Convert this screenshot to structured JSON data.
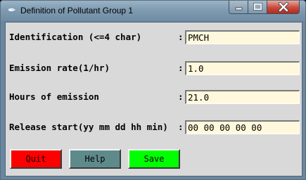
{
  "window": {
    "title": "Definition of Pollutant Group 1",
    "icon": "feather-icon"
  },
  "form": {
    "fields": [
      {
        "label": "Identification (<=4 char)",
        "value": "PMCH"
      },
      {
        "label": "Emission rate(1/hr)",
        "value": "1.0"
      },
      {
        "label": "Hours of emission",
        "value": "21.0"
      },
      {
        "label": "Release start(yy mm dd hh min)",
        "value": "00 00 00 00 00"
      }
    ],
    "separator": ":"
  },
  "buttons": {
    "quit": {
      "label": "Quit",
      "color": "#ff0000"
    },
    "help": {
      "label": "Help",
      "color": "#5f8a8b"
    },
    "save": {
      "label": "Save",
      "color": "#00ff00"
    }
  },
  "colors": {
    "client_bg": "#d9d9d9",
    "field_bg": "#fff8dc",
    "titlebar": "#7f9bb1",
    "close_button": "#c8493a"
  }
}
